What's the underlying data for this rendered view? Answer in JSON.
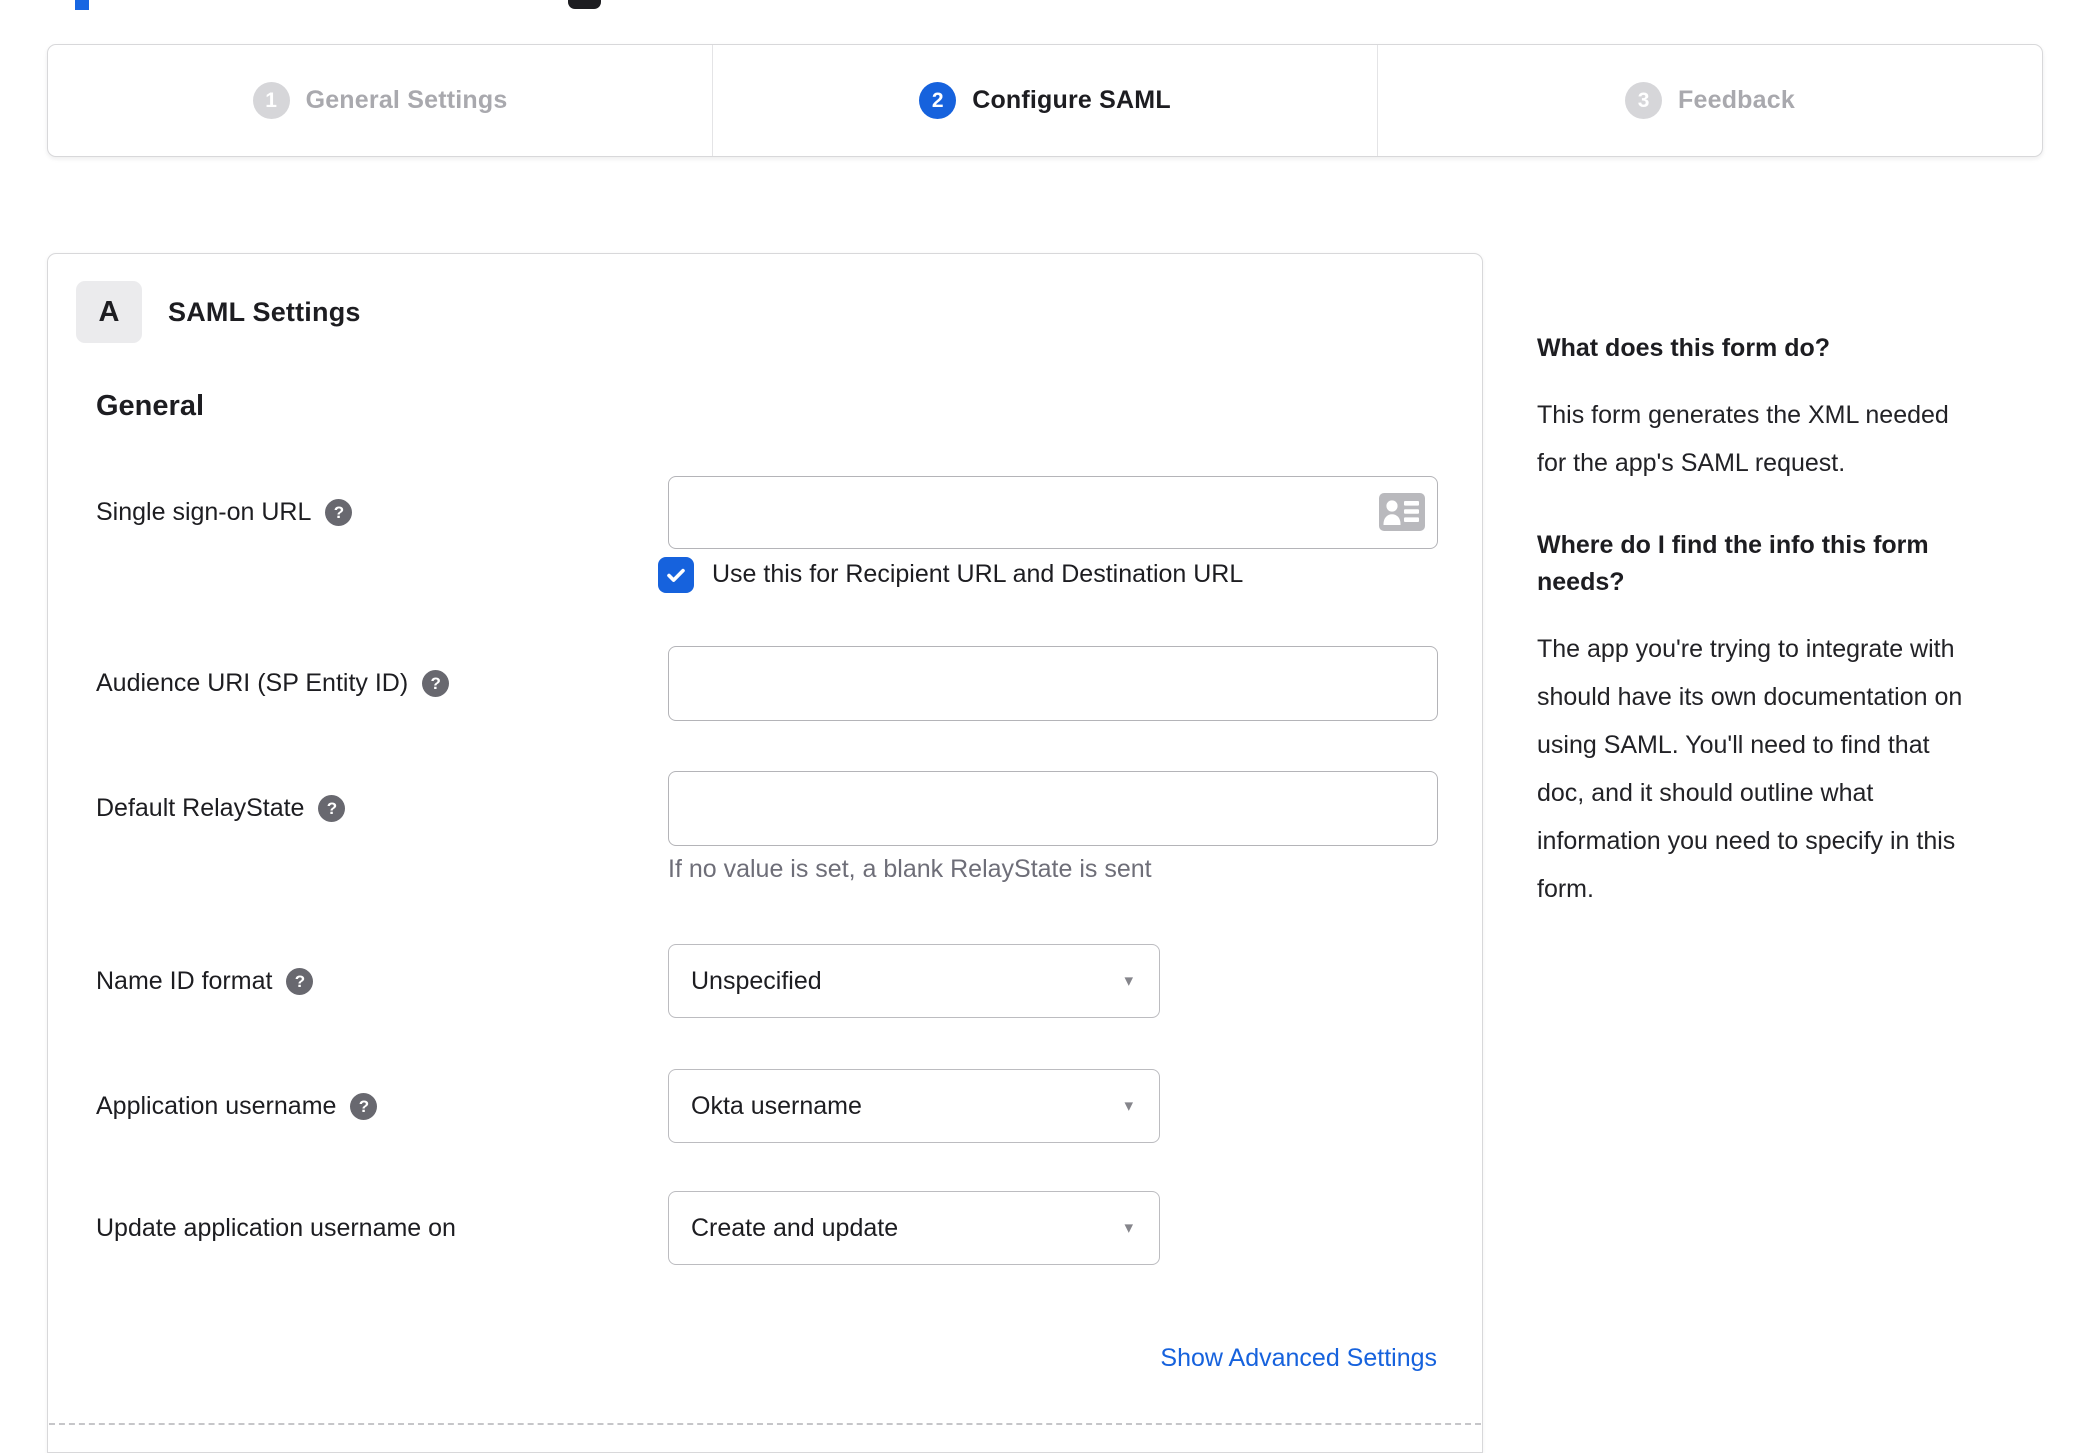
{
  "stepper": {
    "active_step": "Configure SAML",
    "steps": [
      {
        "number": "1",
        "label": "General Settings"
      },
      {
        "number": "2",
        "label": "Configure SAML"
      },
      {
        "number": "3",
        "label": "Feedback"
      }
    ]
  },
  "form": {
    "section_badge": "A",
    "section_title": "SAML Settings",
    "group_heading": "General",
    "help_glyph": "?",
    "select_caret": "▾",
    "fields": {
      "sso_url": {
        "label": "Single sign-on URL",
        "value": ""
      },
      "sso_checkbox": {
        "label": "Use this for Recipient URL and Destination URL",
        "checked": true
      },
      "audience_uri": {
        "label": "Audience URI (SP Entity ID)",
        "value": ""
      },
      "relay_state": {
        "label": "Default RelayState",
        "value": "",
        "hint": "If no value is set, a blank RelayState is sent"
      },
      "name_id_format": {
        "label": "Name ID format",
        "value": "Unspecified"
      },
      "app_username": {
        "label": "Application username",
        "value": "Okta username"
      },
      "update_username": {
        "label": "Update application username on",
        "value": "Create and update"
      }
    },
    "advanced_link": "Show Advanced Settings"
  },
  "sidebar": {
    "sections": [
      {
        "heading": "What does this form do?",
        "body": "This form generates the XML needed\nfor the app's SAML request."
      },
      {
        "heading": "Where do I find the info this form\nneeds?",
        "body": "The app you're trying to integrate with\nshould have its own documentation on\nusing SAML. You'll need to find that\ndoc, and it should outline what\ninformation you need to specify in this\nform."
      }
    ]
  },
  "colors": {
    "accent_blue": "#1662dd",
    "inactive_gray": "#d6d6d9",
    "link_blue": "#1662dd",
    "hint_gray": "#6e6e78"
  }
}
